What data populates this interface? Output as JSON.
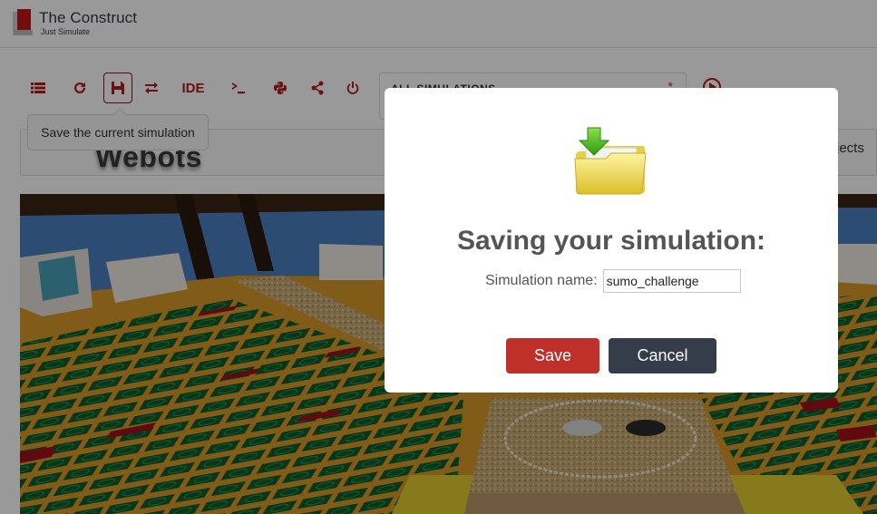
{
  "header": {
    "brand_title": "The Construct",
    "brand_subtitle": "Just Simulate"
  },
  "toolbar": {
    "buttons": [
      {
        "name": "list",
        "icon": "list-icon"
      },
      {
        "name": "reload",
        "icon": "refresh-icon"
      },
      {
        "name": "save",
        "icon": "floppy-disk-icon",
        "active": true
      },
      {
        "name": "switch",
        "icon": "exchange-icon"
      },
      {
        "name": "ide",
        "label": "IDE"
      },
      {
        "name": "terminal",
        "icon": "terminal-icon"
      },
      {
        "name": "python",
        "icon": "python-icon"
      },
      {
        "name": "share",
        "icon": "share-icon"
      },
      {
        "name": "power",
        "icon": "power-icon"
      }
    ],
    "ide_label": "IDE",
    "simulation_select": {
      "label": "ALL SIMULATIONS",
      "required_mark": "*"
    },
    "run_icon": "play-circle-icon"
  },
  "tooltip": {
    "text": "Save the current simulation"
  },
  "panel": {
    "title": "Webots",
    "objects_tab": "Objects"
  },
  "modal": {
    "icon": "folder-download-icon",
    "title": "Saving your simulation:",
    "name_label": "Simulation name:",
    "name_value": "sumo_challenge",
    "save_label": "Save",
    "cancel_label": "Cancel"
  },
  "colors": {
    "accent": "#b11c1c",
    "save_button": "#c0302a",
    "cancel_button": "#353d4a",
    "overlay": "rgba(0,0,0,0.4)"
  }
}
